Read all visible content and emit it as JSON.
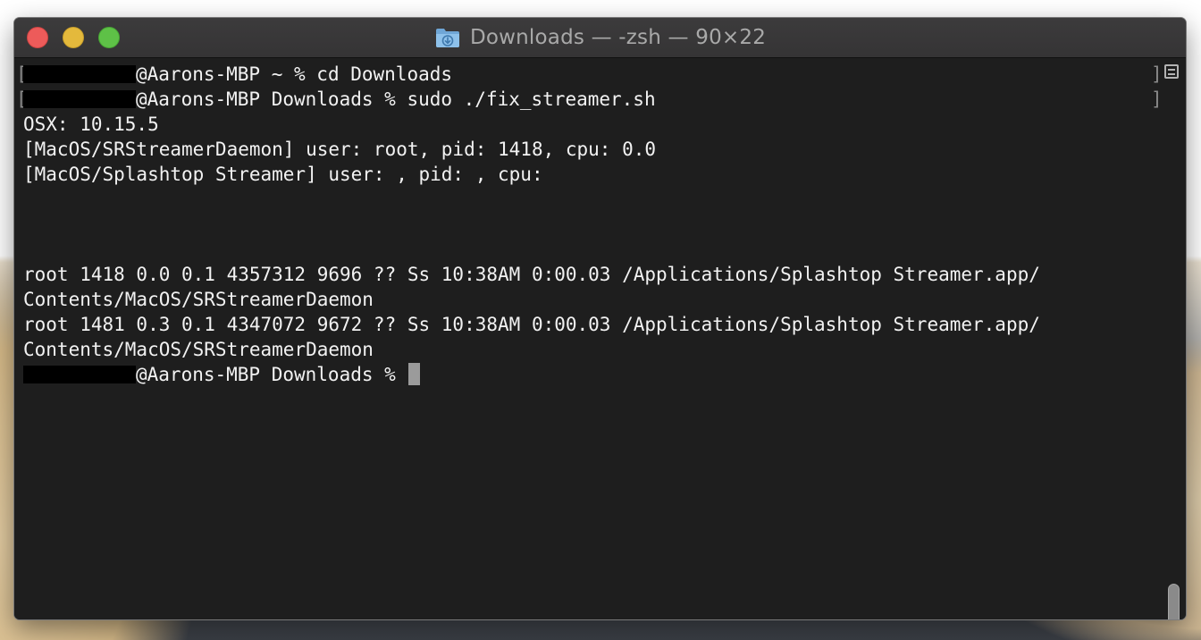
{
  "window": {
    "title": "Downloads — -zsh — 90×22",
    "folder_icon": "downloads-folder-icon",
    "traffic_lights": {
      "close_color": "#ed5b5a",
      "minimize_color": "#e4b93c",
      "zoom_color": "#5ec147"
    }
  },
  "terminal": {
    "lines": [
      {
        "prompt_suffix": "@Aarons-MBP ~ % ",
        "command": "cd Downloads"
      },
      {
        "prompt_suffix": "@Aarons-MBP Downloads % ",
        "command": "sudo ./fix_streamer.sh"
      },
      {
        "text": "OSX: 10.15.5"
      },
      {
        "text": "[MacOS/SRStreamerDaemon] user: root, pid: 1418, cpu: 0.0"
      },
      {
        "text": "[MacOS/Splashtop Streamer] user: , pid: , cpu:"
      },
      {
        "text": "root 1418 0.0 0.1 4357312 9696 ?? Ss 10:38AM 0:00.03 /Applications/Splashtop Streamer.app/"
      },
      {
        "text": "Contents/MacOS/SRStreamerDaemon"
      },
      {
        "text": "root 1481 0.3 0.1 4347072 9672 ?? Ss 10:38AM 0:00.03 /Applications/Splashtop Streamer.app/"
      },
      {
        "text": "Contents/MacOS/SRStreamerDaemon"
      },
      {
        "prompt_suffix": "@Aarons-MBP Downloads % "
      }
    ],
    "bracket_open": "[",
    "bracket_close": "]",
    "text_color": "#f2f2f2",
    "background_color": "#1e1e1e"
  }
}
